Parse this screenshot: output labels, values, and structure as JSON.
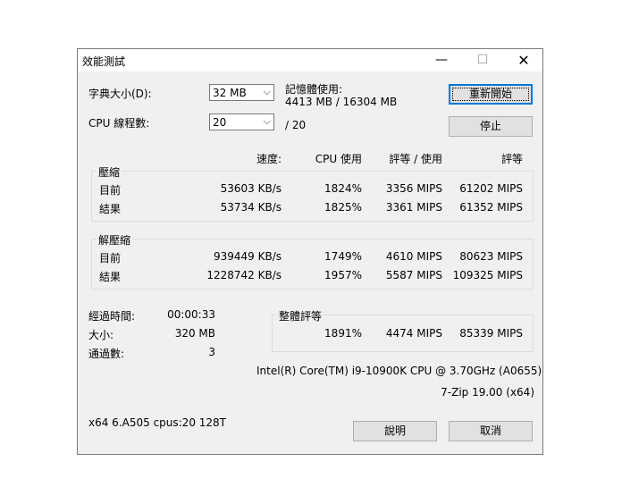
{
  "window": {
    "title": "效能測試",
    "min_glyph": "—",
    "max_glyph": "☐",
    "close_glyph": "✕"
  },
  "dict": {
    "label": "字典大小(D):",
    "value": "32 MB"
  },
  "threads": {
    "label": "CPU 線程數:",
    "value": "20",
    "max": "/ 20"
  },
  "memory": {
    "label": "記憶體使用:",
    "value": "4413 MB / 16304 MB"
  },
  "buttons": {
    "restart": "重新開始",
    "stop": "停止",
    "help": "說明",
    "cancel": "取消"
  },
  "headers": {
    "speed": "速度:",
    "cpu": "CPU 使用",
    "rating_usage": "評等 / 使用",
    "rating": "評等"
  },
  "compress": {
    "title": "壓縮",
    "rows": [
      {
        "label": "目前",
        "speed": "53603 KB/s",
        "cpu": "1824%",
        "rpu": "3356 MIPS",
        "rating": "61202 MIPS"
      },
      {
        "label": "結果",
        "speed": "53734 KB/s",
        "cpu": "1825%",
        "rpu": "3361 MIPS",
        "rating": "61352 MIPS"
      }
    ]
  },
  "decompress": {
    "title": "解壓縮",
    "rows": [
      {
        "label": "目前",
        "speed": "939449 KB/s",
        "cpu": "1749%",
        "rpu": "4610 MIPS",
        "rating": "80623 MIPS"
      },
      {
        "label": "結果",
        "speed": "1228742 KB/s",
        "cpu": "1957%",
        "rpu": "5587 MIPS",
        "rating": "109325 MIPS"
      }
    ]
  },
  "stats": {
    "elapsed_label": "經過時間:",
    "elapsed": "00:00:33",
    "size_label": "大小:",
    "size": "320 MB",
    "passes_label": "通過數:",
    "passes": "3"
  },
  "overall": {
    "title": "整體評等",
    "cpu": "1891%",
    "rpu": "4474 MIPS",
    "rating": "85339 MIPS"
  },
  "cpu_info": "Intel(R) Core(TM) i9-10900K CPU @ 3.70GHz (A0655)",
  "version": "7-Zip 19.00 (x64)",
  "sysinfo": "x64 6.A505 cpus:20 128T"
}
